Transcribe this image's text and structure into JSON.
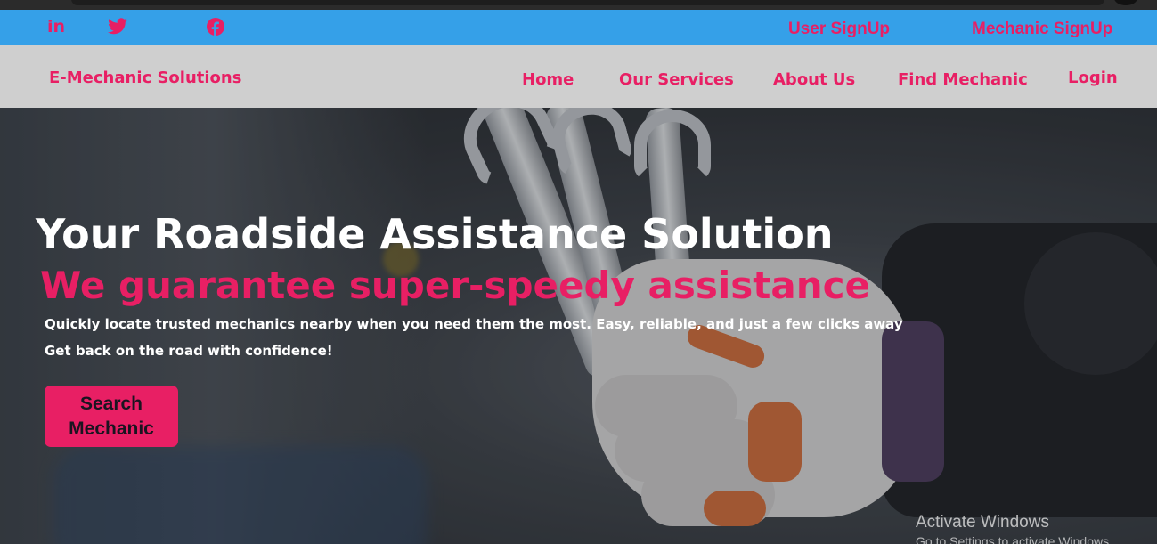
{
  "topbar": {
    "social_icons": [
      "linkedin-icon",
      "twitter-icon",
      "facebook-icon"
    ],
    "user_signup": "User SignUp",
    "mechanic_signup": "Mechanic SignUp"
  },
  "navbar": {
    "brand": "E-Mechanic Solutions",
    "links": [
      "Home",
      "Our Services",
      "About Us",
      "Find Mechanic",
      "Login"
    ]
  },
  "hero": {
    "title": "Your Roadside Assistance Solution",
    "subtitle": "We guarantee super-speedy assistance",
    "line1": "Quickly locate trusted mechanics nearby when you need them the most. Easy, reliable, and just a few clicks away",
    "line2": "Get back on the road with confidence!",
    "button_line1": "Search",
    "button_line2": "Mechanic"
  },
  "watermark": {
    "title": "Activate Windows",
    "subtitle": "Go to Settings to activate Windows."
  },
  "colors": {
    "topbar_bg": "#35a0e8",
    "navbar_bg": "#cfcfcf",
    "accent": "#e81f64"
  }
}
